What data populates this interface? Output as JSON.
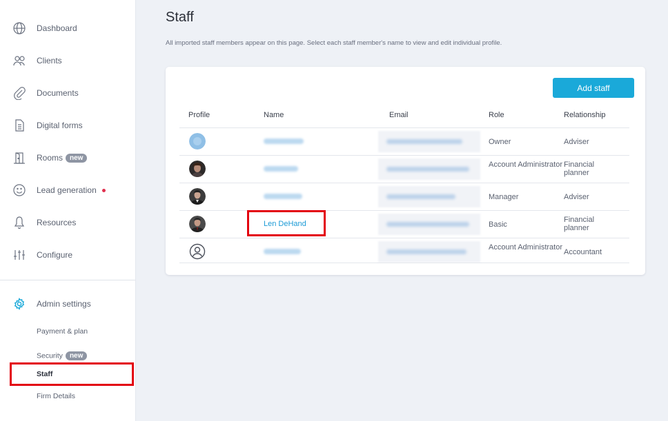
{
  "sidebar": {
    "items": [
      {
        "label": "Dashboard",
        "icon": "globe-icon"
      },
      {
        "label": "Clients",
        "icon": "users-icon"
      },
      {
        "label": "Documents",
        "icon": "paperclip-icon"
      },
      {
        "label": "Digital forms",
        "icon": "form-icon"
      },
      {
        "label": "Rooms",
        "icon": "door-icon",
        "badge": "new"
      },
      {
        "label": "Lead generation",
        "icon": "smiley-icon"
      },
      {
        "label": "Resources",
        "icon": "bell-icon"
      },
      {
        "label": "Configure",
        "icon": "sliders-icon"
      }
    ],
    "admin": {
      "label": "Admin settings",
      "icon": "gear-icon",
      "sub_items": [
        {
          "label": "Payment & plan"
        },
        {
          "label": "Security",
          "badge": "new"
        },
        {
          "label": "Staff"
        },
        {
          "label": "Firm Details"
        }
      ]
    },
    "accent_color": "#1aa9d9",
    "highlight_color": "#e3000f"
  },
  "main": {
    "title": "Staff",
    "subtitle": "All imported staff members appear on this page. Select each staff member's name to view and edit individual profile.",
    "add_button": "Add staff",
    "columns": [
      "Profile",
      "Name",
      "Email",
      "Role",
      "Relationship"
    ],
    "rows": [
      {
        "role": "Owner",
        "relationship": "Adviser"
      },
      {
        "role": "Account Administrator",
        "relationship": "Financial planner"
      },
      {
        "role": "Manager",
        "relationship": "Adviser"
      },
      {
        "name": "Len DeHand",
        "role": "Basic",
        "relationship": "Financial planner"
      },
      {
        "role": "Account Administrator",
        "relationship": "Accountant"
      }
    ]
  }
}
